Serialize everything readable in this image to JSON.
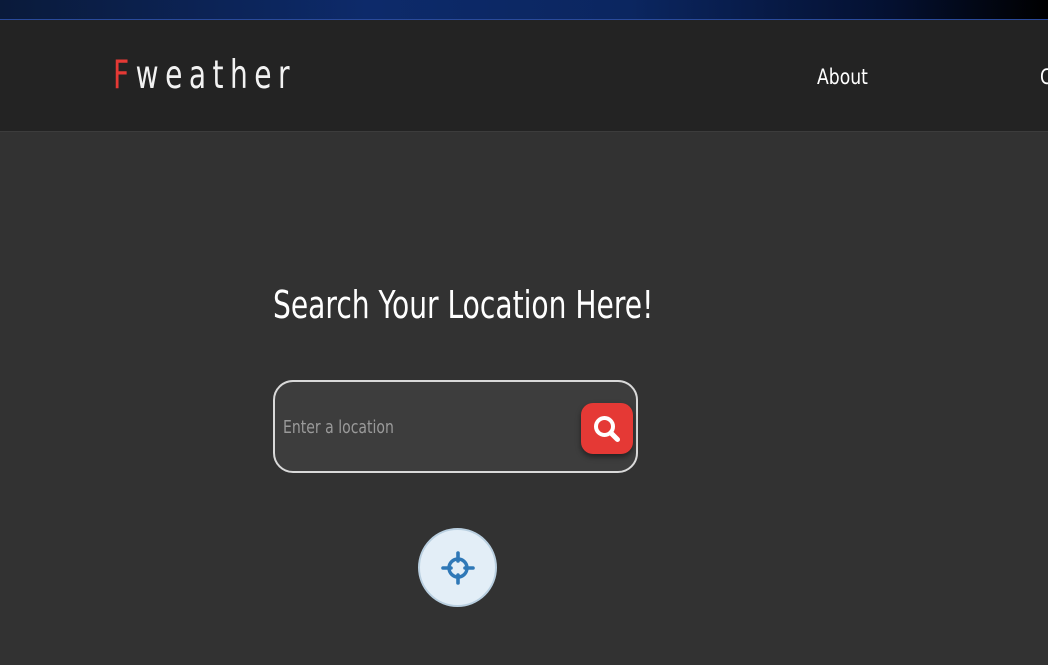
{
  "header": {
    "logo_accent": "F",
    "logo_rest": "weather",
    "nav": {
      "about": "About",
      "contact": "C"
    }
  },
  "main": {
    "heading": "Search Your Location Here!",
    "search": {
      "placeholder": "Enter a location",
      "value": "",
      "button_icon": "search-icon"
    },
    "locate_button": {
      "icon": "crosshair-icon"
    }
  },
  "colors": {
    "accent": "#e53935",
    "background": "#323232",
    "navbar": "#232323",
    "locate_icon": "#2f78b7"
  }
}
